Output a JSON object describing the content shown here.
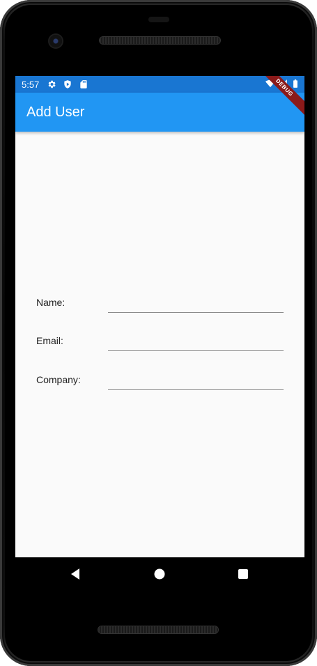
{
  "status_bar": {
    "time": "5:57",
    "left_icons": [
      "gear-icon",
      "play-protect-icon",
      "sd-card-icon"
    ],
    "right_icons": [
      "wifi-icon",
      "signal-icon",
      "battery-icon"
    ],
    "debug_label": "DEBUG"
  },
  "app_bar": {
    "title": "Add User",
    "color": "#2196f3"
  },
  "form": {
    "fields": [
      {
        "label": "Name:",
        "value": ""
      },
      {
        "label": "Email:",
        "value": ""
      },
      {
        "label": "Company:",
        "value": ""
      }
    ]
  },
  "nav_bar": {
    "buttons": [
      "back-icon",
      "home-icon",
      "recents-icon"
    ]
  },
  "colors": {
    "status_bar": "#1976d2",
    "background": "#fafafa",
    "debug_ribbon": "#8b1a1a"
  }
}
